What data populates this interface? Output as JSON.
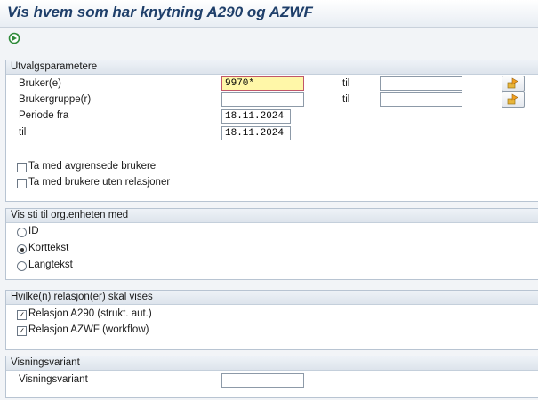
{
  "window": {
    "title": "Vis hvem som har knytning A290 og AZWF"
  },
  "toolbar": {
    "execute_icon": "execute-icon"
  },
  "selection": {
    "header": "Utvalgsparametere",
    "user_label": "Bruker(e)",
    "user_value": "9970*",
    "user_to_label": "til",
    "user_to_value": "",
    "group_label": "Brukergruppe(r)",
    "group_value": "",
    "group_to_label": "til",
    "group_to_value": "",
    "period_from_label": "Periode fra",
    "period_from_value": "18.11.2024",
    "period_to_label": "til",
    "period_to_value": "18.11.2024",
    "include_limited_label": "Ta med avgrensede brukere",
    "include_limited_checked": false,
    "include_norel_label": "Ta med brukere uten relasjoner",
    "include_norel_checked": false
  },
  "path": {
    "header": "Vis sti til org.enheten med",
    "options": [
      {
        "label": "ID",
        "selected": false
      },
      {
        "label": "Korttekst",
        "selected": true
      },
      {
        "label": "Langtekst",
        "selected": false
      }
    ]
  },
  "relations": {
    "header": "Hvilke(n) relasjon(er) skal vises",
    "a290_label": "Relasjon A290 (strukt. aut.)",
    "a290_checked": true,
    "azwf_label": "Relasjon AZWF (workflow)",
    "azwf_checked": true
  },
  "variant": {
    "header": "Visningsvariant",
    "label": "Visningsvariant",
    "value": ""
  }
}
